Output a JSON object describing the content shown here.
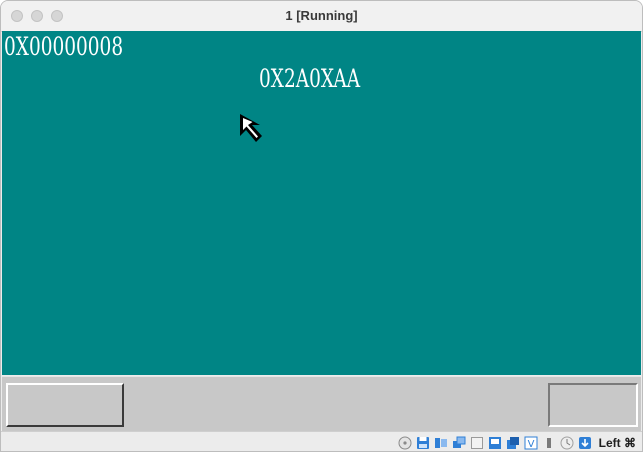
{
  "window": {
    "title": "1 [Running]"
  },
  "screen": {
    "background": "#008585",
    "text_color": "#ffffff",
    "top_left_value": "0X00000008",
    "center_value": "0X2A0XAA",
    "pointer_icon": "arrow-cursor-icon"
  },
  "panel": {
    "background": "#c8c8c8"
  },
  "statusbar": {
    "icons": [
      "optical-drive-icon",
      "floppy-disk-icon",
      "audio-icon",
      "network-icon",
      "usb-icon",
      "shared-folder-icon",
      "display-icon",
      "video-capture-icon",
      "cpu-icon",
      "mouse-integration-icon",
      "host-key-arrow-icon"
    ],
    "host_key": "Left ⌘"
  }
}
